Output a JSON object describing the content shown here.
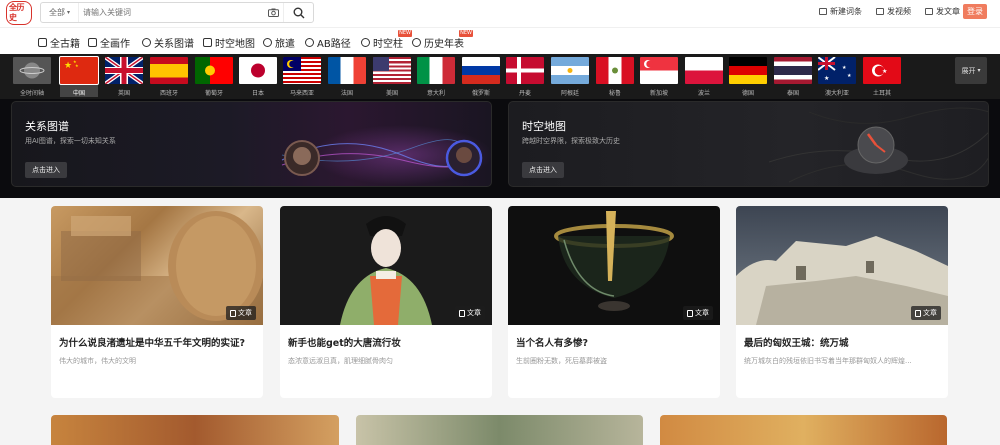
{
  "header": {
    "logo_text": "全历史",
    "search_scope": "全部",
    "search_placeholder": "请输入关键词",
    "actions": [
      {
        "label": "新建词条",
        "icon": "edit-icon"
      },
      {
        "label": "发视频",
        "icon": "video-icon"
      },
      {
        "label": "发文章",
        "icon": "article-icon"
      }
    ],
    "login_label": "登录"
  },
  "nav": {
    "items": [
      {
        "label": "全古籍",
        "icon": "book-icon"
      },
      {
        "label": "全画作",
        "icon": "painting-icon"
      },
      {
        "label": "关系图谱",
        "icon": "graph-icon"
      },
      {
        "label": "时空地图",
        "icon": "map-icon"
      },
      {
        "label": "旅遣",
        "icon": "person-icon"
      },
      {
        "label": "AB路径",
        "icon": "path-icon"
      },
      {
        "label": "时空柱",
        "icon": "pillar-icon"
      },
      {
        "label": "历史年表",
        "icon": "clock-icon"
      }
    ],
    "new_badge": "NEW"
  },
  "flags": {
    "items": [
      {
        "label": "全时间轴"
      },
      {
        "label": "中国"
      },
      {
        "label": "英国"
      },
      {
        "label": "西班牙"
      },
      {
        "label": "葡萄牙"
      },
      {
        "label": "日本"
      },
      {
        "label": "马来西亚"
      },
      {
        "label": "法国"
      },
      {
        "label": "美国"
      },
      {
        "label": "意大利"
      },
      {
        "label": "俄罗斯"
      },
      {
        "label": "丹麦"
      },
      {
        "label": "阿根廷"
      },
      {
        "label": "秘鲁"
      },
      {
        "label": "新加坡"
      },
      {
        "label": "波兰"
      },
      {
        "label": "德国"
      },
      {
        "label": "泰国"
      },
      {
        "label": "澳大利亚"
      },
      {
        "label": "土耳其"
      }
    ],
    "expand_label": "展开"
  },
  "banners": [
    {
      "title": "关系图谱",
      "subtitle": "用AI图谱，探索一切未知关系",
      "button": "点击进入"
    },
    {
      "title": "时空地图",
      "subtitle": "跨越时空界限，探索极致大历史",
      "button": "点击进入"
    }
  ],
  "cards": [
    {
      "title": "为什么说良渚遗址是中华五千年文明的实证?",
      "desc": "伟大的城市，伟大的文明",
      "badge": "文章"
    },
    {
      "title": "新手也能get的大唐流行妆",
      "desc": "态浓意远淑且真，肌理细腻骨肉匀",
      "badge": "文章"
    },
    {
      "title": "当个名人有多惨?",
      "desc": "生前圈粉无数，死后墓葬被盗",
      "badge": "文章"
    },
    {
      "title": "最后的匈奴王城：统万城",
      "desc": "统万城灰白的残垣依旧书写着当年那群匈奴人的辉煌...",
      "badge": "文章"
    }
  ]
}
